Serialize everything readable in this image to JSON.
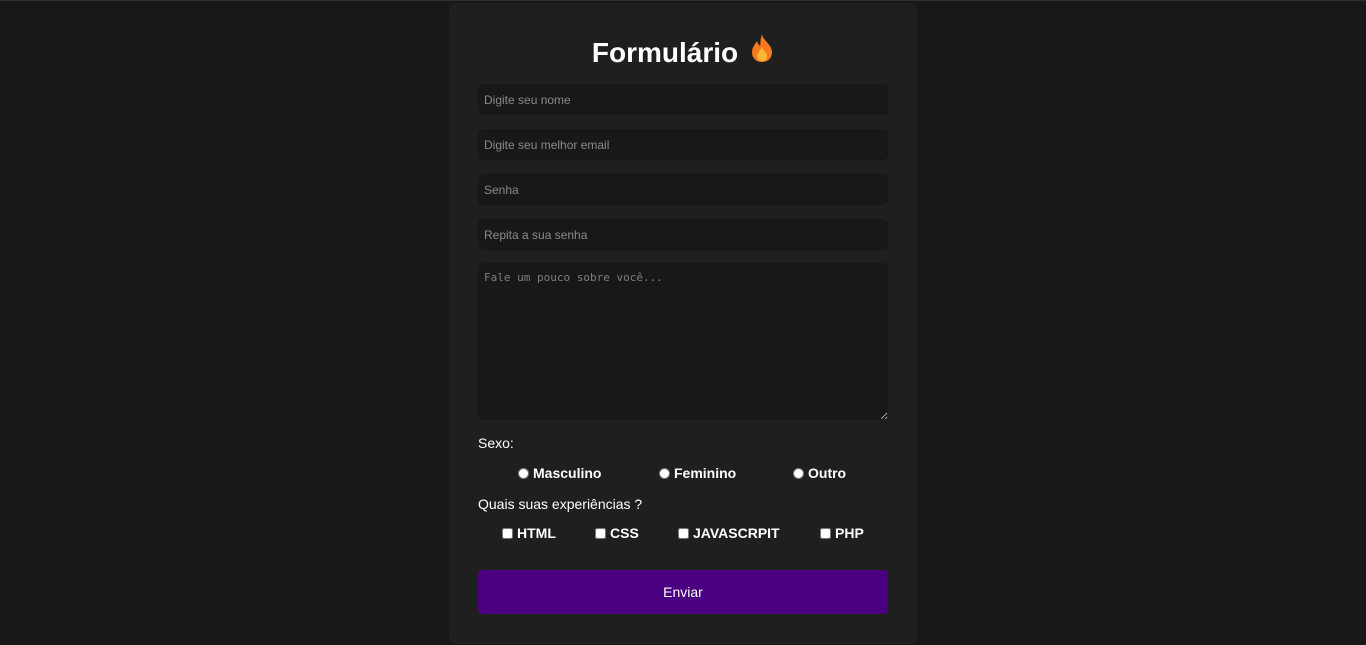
{
  "form": {
    "title": "Formulário",
    "title_icon": "fire-icon",
    "name_placeholder": "Digite seu nome",
    "email_placeholder": "Digite seu melhor email",
    "password_placeholder": "Senha",
    "repeat_password_placeholder": "Repita a sua senha",
    "about_placeholder": "Fale um pouco sobre você...",
    "sex_label": "Sexo:",
    "sex_options": [
      "Masculino",
      "Feminino",
      "Outro"
    ],
    "experience_label": "Quais suas experiências ?",
    "experience_options": [
      "HTML",
      "CSS",
      "JAVASCRPIT",
      "PHP"
    ],
    "submit_label": "Enviar"
  },
  "colors": {
    "page_background": "#181818",
    "card_background": "#1f1f1f",
    "field_background": "#181818",
    "submit_background": "#4b0081",
    "text": "#ffffff"
  }
}
